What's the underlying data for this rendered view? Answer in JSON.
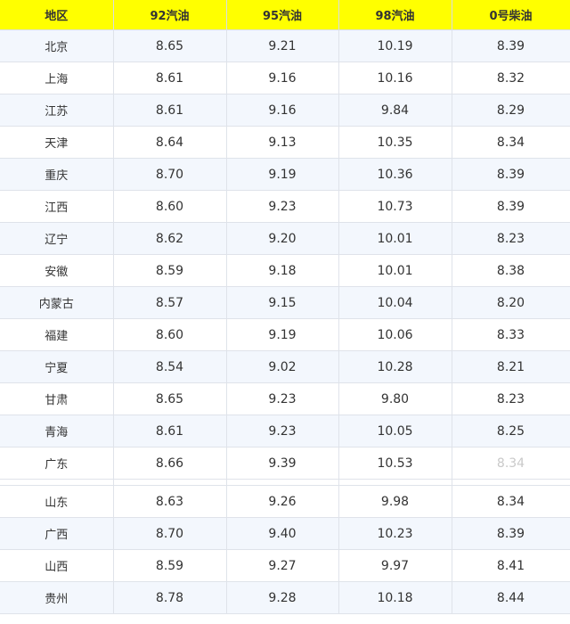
{
  "table": {
    "headers": [
      "地区",
      "92汽油",
      "95汽油",
      "98汽油",
      "0号柴油"
    ],
    "rows_top": [
      [
        "北京",
        "8.65",
        "9.21",
        "10.19",
        "8.39"
      ],
      [
        "上海",
        "8.61",
        "9.16",
        "10.16",
        "8.32"
      ],
      [
        "江苏",
        "8.61",
        "9.16",
        "9.84",
        "8.29"
      ],
      [
        "天津",
        "8.64",
        "9.13",
        "10.35",
        "8.34"
      ],
      [
        "重庆",
        "8.70",
        "9.19",
        "10.36",
        "8.39"
      ],
      [
        "江西",
        "8.60",
        "9.23",
        "10.73",
        "8.39"
      ],
      [
        "辽宁",
        "8.62",
        "9.20",
        "10.01",
        "8.23"
      ],
      [
        "安徽",
        "8.59",
        "9.18",
        "10.01",
        "8.38"
      ],
      [
        "内蒙古",
        "8.57",
        "9.15",
        "10.04",
        "8.20"
      ],
      [
        "福建",
        "8.60",
        "9.19",
        "10.06",
        "8.33"
      ],
      [
        "宁夏",
        "8.54",
        "9.02",
        "10.28",
        "8.21"
      ],
      [
        "甘肃",
        "8.65",
        "9.23",
        "9.80",
        "8.23"
      ],
      [
        "青海",
        "8.61",
        "9.23",
        "10.05",
        "8.25"
      ],
      [
        "广东",
        "8.66",
        "9.39",
        "10.53",
        "8.34"
      ]
    ],
    "rows_bottom": [
      [
        "山东",
        "8.63",
        "9.26",
        "9.98",
        "8.34"
      ],
      [
        "广西",
        "8.70",
        "9.40",
        "10.23",
        "8.39"
      ],
      [
        "山西",
        "8.59",
        "9.27",
        "9.97",
        "8.41"
      ],
      [
        "贵州",
        "8.78",
        "9.28",
        "10.18",
        "8.44"
      ]
    ]
  }
}
